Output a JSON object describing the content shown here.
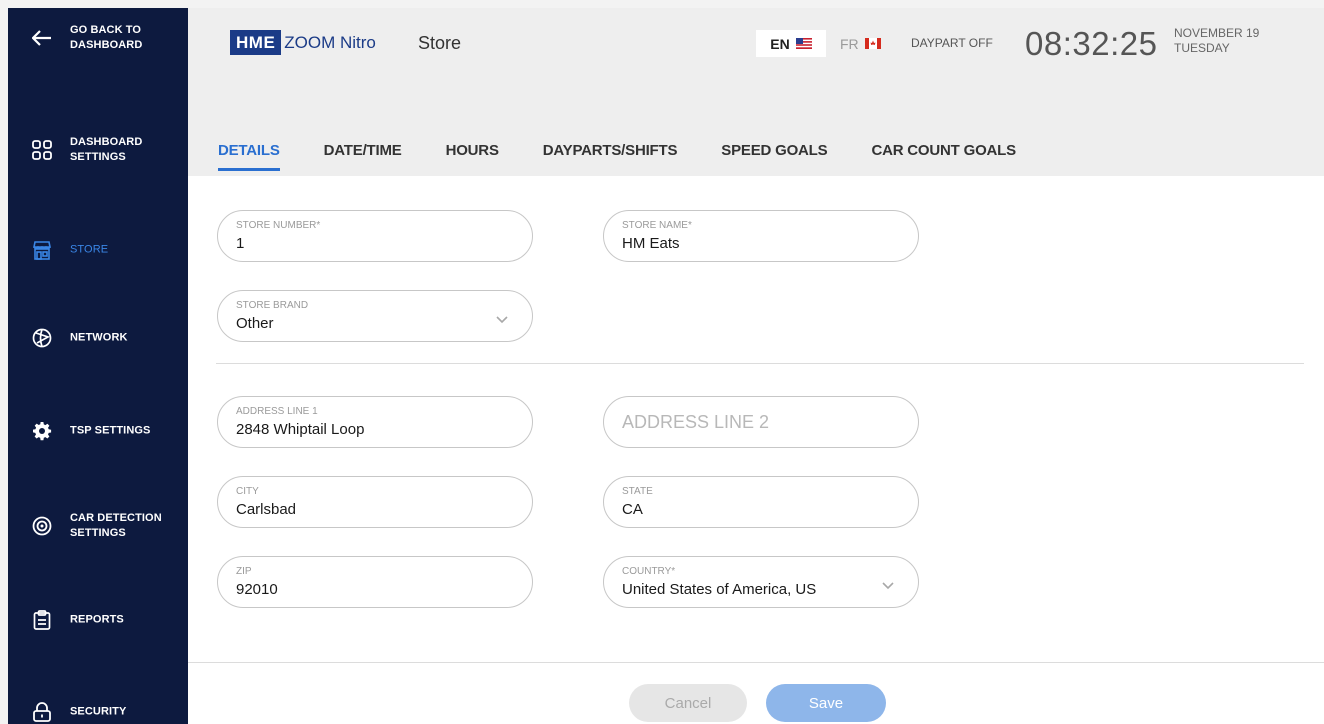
{
  "sidebar": {
    "items": [
      {
        "id": "back",
        "label": "GO BACK TO\nDASHBOARD",
        "icon": "arrow-left-icon"
      },
      {
        "id": "dashboard-settings",
        "label": "DASHBOARD\nSETTINGS",
        "icon": "grid-icon"
      },
      {
        "id": "store",
        "label": "STORE",
        "icon": "store-icon",
        "active": true
      },
      {
        "id": "network",
        "label": "NETWORK",
        "icon": "network-icon"
      },
      {
        "id": "tsp-settings",
        "label": "TSP SETTINGS",
        "icon": "gear-icon"
      },
      {
        "id": "car-detection",
        "label": "CAR DETECTION\nSETTINGS",
        "icon": "radar-icon"
      },
      {
        "id": "reports",
        "label": "REPORTS",
        "icon": "clipboard-icon"
      },
      {
        "id": "security",
        "label": "SECURITY",
        "icon": "lock-icon"
      }
    ]
  },
  "header": {
    "logo_hme": "HME",
    "logo_product": "ZOOM Nitro",
    "page_title": "Store",
    "lang_en": "EN",
    "lang_fr": "FR",
    "daypart": "DAYPART OFF",
    "clock": "08:32:25",
    "date": "NOVEMBER 19",
    "weekday": "TUESDAY"
  },
  "tabs": [
    {
      "label": "DETAILS",
      "active": true
    },
    {
      "label": "DATE/TIME"
    },
    {
      "label": "HOURS"
    },
    {
      "label": "DAYPARTS/SHIFTS"
    },
    {
      "label": "SPEED GOALS"
    },
    {
      "label": "CAR COUNT GOALS"
    }
  ],
  "form": {
    "store_number": {
      "label": "STORE NUMBER*",
      "value": "1"
    },
    "store_name": {
      "label": "STORE NAME*",
      "value": "HM Eats"
    },
    "store_brand": {
      "label": "STORE BRAND",
      "value": "Other"
    },
    "address1": {
      "label": "ADDRESS LINE 1",
      "value": "2848 Whiptail Loop"
    },
    "address2": {
      "placeholder": "ADDRESS LINE 2",
      "value": ""
    },
    "city": {
      "label": "CITY",
      "value": "Carlsbad"
    },
    "state": {
      "label": "STATE",
      "value": "CA"
    },
    "zip": {
      "label": "ZIP",
      "value": "92010"
    },
    "country": {
      "label": "COUNTRY*",
      "value": "United States of America, US"
    }
  },
  "buttons": {
    "cancel": "Cancel",
    "save": "Save"
  },
  "colors": {
    "sidebar_bg": "#0d1a3f",
    "accent": "#2a6fd0",
    "save_button": "#8eb6ea"
  }
}
